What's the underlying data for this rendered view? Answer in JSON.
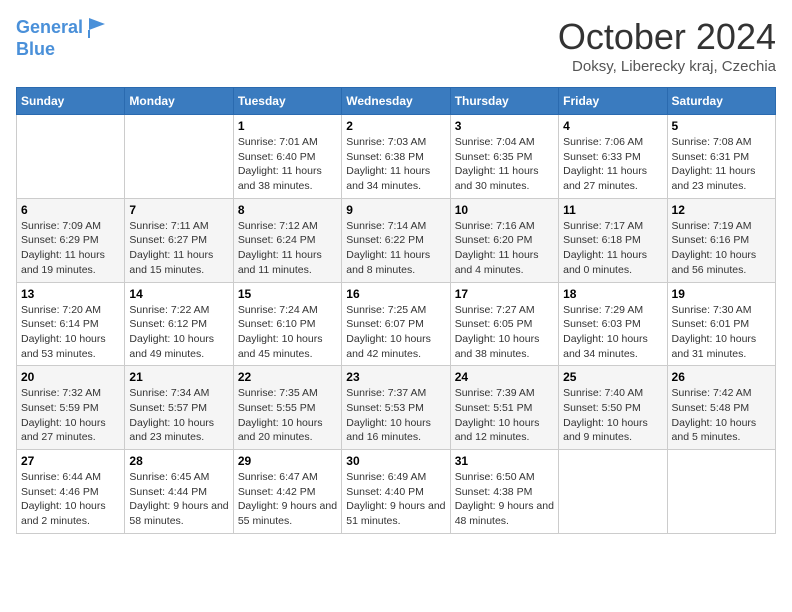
{
  "header": {
    "logo_line1": "General",
    "logo_line2": "Blue",
    "month": "October 2024",
    "location": "Doksy, Liberecky kraj, Czechia"
  },
  "days_of_week": [
    "Sunday",
    "Monday",
    "Tuesday",
    "Wednesday",
    "Thursday",
    "Friday",
    "Saturday"
  ],
  "weeks": [
    [
      {
        "day": "",
        "info": ""
      },
      {
        "day": "",
        "info": ""
      },
      {
        "day": "1",
        "info": "Sunrise: 7:01 AM\nSunset: 6:40 PM\nDaylight: 11 hours and 38 minutes."
      },
      {
        "day": "2",
        "info": "Sunrise: 7:03 AM\nSunset: 6:38 PM\nDaylight: 11 hours and 34 minutes."
      },
      {
        "day": "3",
        "info": "Sunrise: 7:04 AM\nSunset: 6:35 PM\nDaylight: 11 hours and 30 minutes."
      },
      {
        "day": "4",
        "info": "Sunrise: 7:06 AM\nSunset: 6:33 PM\nDaylight: 11 hours and 27 minutes."
      },
      {
        "day": "5",
        "info": "Sunrise: 7:08 AM\nSunset: 6:31 PM\nDaylight: 11 hours and 23 minutes."
      }
    ],
    [
      {
        "day": "6",
        "info": "Sunrise: 7:09 AM\nSunset: 6:29 PM\nDaylight: 11 hours and 19 minutes."
      },
      {
        "day": "7",
        "info": "Sunrise: 7:11 AM\nSunset: 6:27 PM\nDaylight: 11 hours and 15 minutes."
      },
      {
        "day": "8",
        "info": "Sunrise: 7:12 AM\nSunset: 6:24 PM\nDaylight: 11 hours and 11 minutes."
      },
      {
        "day": "9",
        "info": "Sunrise: 7:14 AM\nSunset: 6:22 PM\nDaylight: 11 hours and 8 minutes."
      },
      {
        "day": "10",
        "info": "Sunrise: 7:16 AM\nSunset: 6:20 PM\nDaylight: 11 hours and 4 minutes."
      },
      {
        "day": "11",
        "info": "Sunrise: 7:17 AM\nSunset: 6:18 PM\nDaylight: 11 hours and 0 minutes."
      },
      {
        "day": "12",
        "info": "Sunrise: 7:19 AM\nSunset: 6:16 PM\nDaylight: 10 hours and 56 minutes."
      }
    ],
    [
      {
        "day": "13",
        "info": "Sunrise: 7:20 AM\nSunset: 6:14 PM\nDaylight: 10 hours and 53 minutes."
      },
      {
        "day": "14",
        "info": "Sunrise: 7:22 AM\nSunset: 6:12 PM\nDaylight: 10 hours and 49 minutes."
      },
      {
        "day": "15",
        "info": "Sunrise: 7:24 AM\nSunset: 6:10 PM\nDaylight: 10 hours and 45 minutes."
      },
      {
        "day": "16",
        "info": "Sunrise: 7:25 AM\nSunset: 6:07 PM\nDaylight: 10 hours and 42 minutes."
      },
      {
        "day": "17",
        "info": "Sunrise: 7:27 AM\nSunset: 6:05 PM\nDaylight: 10 hours and 38 minutes."
      },
      {
        "day": "18",
        "info": "Sunrise: 7:29 AM\nSunset: 6:03 PM\nDaylight: 10 hours and 34 minutes."
      },
      {
        "day": "19",
        "info": "Sunrise: 7:30 AM\nSunset: 6:01 PM\nDaylight: 10 hours and 31 minutes."
      }
    ],
    [
      {
        "day": "20",
        "info": "Sunrise: 7:32 AM\nSunset: 5:59 PM\nDaylight: 10 hours and 27 minutes."
      },
      {
        "day": "21",
        "info": "Sunrise: 7:34 AM\nSunset: 5:57 PM\nDaylight: 10 hours and 23 minutes."
      },
      {
        "day": "22",
        "info": "Sunrise: 7:35 AM\nSunset: 5:55 PM\nDaylight: 10 hours and 20 minutes."
      },
      {
        "day": "23",
        "info": "Sunrise: 7:37 AM\nSunset: 5:53 PM\nDaylight: 10 hours and 16 minutes."
      },
      {
        "day": "24",
        "info": "Sunrise: 7:39 AM\nSunset: 5:51 PM\nDaylight: 10 hours and 12 minutes."
      },
      {
        "day": "25",
        "info": "Sunrise: 7:40 AM\nSunset: 5:50 PM\nDaylight: 10 hours and 9 minutes."
      },
      {
        "day": "26",
        "info": "Sunrise: 7:42 AM\nSunset: 5:48 PM\nDaylight: 10 hours and 5 minutes."
      }
    ],
    [
      {
        "day": "27",
        "info": "Sunrise: 6:44 AM\nSunset: 4:46 PM\nDaylight: 10 hours and 2 minutes."
      },
      {
        "day": "28",
        "info": "Sunrise: 6:45 AM\nSunset: 4:44 PM\nDaylight: 9 hours and 58 minutes."
      },
      {
        "day": "29",
        "info": "Sunrise: 6:47 AM\nSunset: 4:42 PM\nDaylight: 9 hours and 55 minutes."
      },
      {
        "day": "30",
        "info": "Sunrise: 6:49 AM\nSunset: 4:40 PM\nDaylight: 9 hours and 51 minutes."
      },
      {
        "day": "31",
        "info": "Sunrise: 6:50 AM\nSunset: 4:38 PM\nDaylight: 9 hours and 48 minutes."
      },
      {
        "day": "",
        "info": ""
      },
      {
        "day": "",
        "info": ""
      }
    ]
  ]
}
